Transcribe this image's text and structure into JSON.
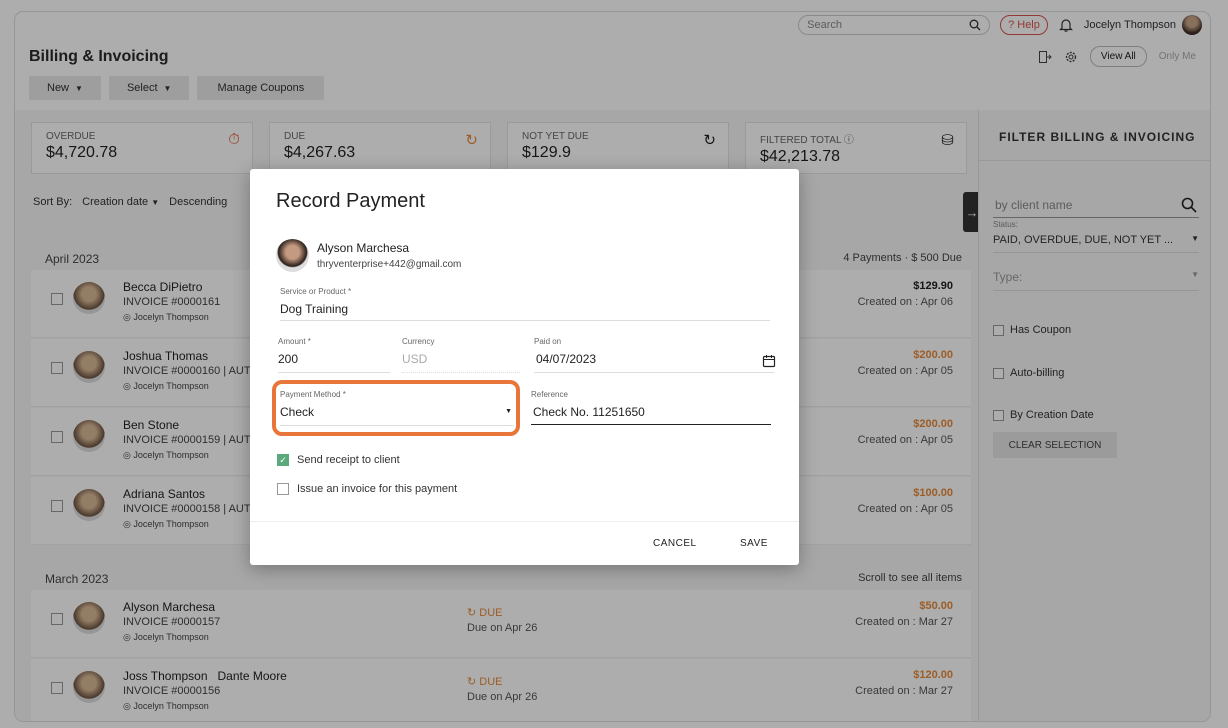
{
  "topbar": {
    "search_placeholder": "Search",
    "help": "Help",
    "user": "Jocelyn Thompson"
  },
  "header": {
    "title": "Billing & Invoicing",
    "view_all": "View All",
    "only_me": "Only Me"
  },
  "toolbar": {
    "new": "New",
    "select": "Select",
    "coupons": "Manage Coupons"
  },
  "cards": [
    {
      "label": "OVERDUE",
      "value": "$4,720.78",
      "icon": "stopwatch-icon",
      "color": "#e0552f"
    },
    {
      "label": "DUE",
      "value": "$4,267.63",
      "icon": "clock-refresh-icon",
      "color": "#e8893a"
    },
    {
      "label": "NOT YET DUE",
      "value": "$129.9",
      "icon": "clock-forward-icon",
      "color": "#333333"
    },
    {
      "label": "FILTERED TOTAL",
      "value": "$42,213.78",
      "icon": "coins-icon",
      "color": "#333333"
    }
  ],
  "sort": {
    "label": "Sort By:",
    "field": "Creation date",
    "order": "Descending"
  },
  "groups": [
    {
      "name": "April 2023",
      "summary": "4 Payments  ·  $ 500 Due"
    },
    {
      "name": "March 2023",
      "summary": "Scroll to see all items"
    }
  ],
  "rows": [
    {
      "name": "Becca DiPietro",
      "invoice": "INVOICE #0000161",
      "assignee": "Jocelyn Thompson",
      "amount": "$129.90",
      "amount_color": "#222222",
      "created": "Created on : Apr 06",
      "status": "",
      "due": ""
    },
    {
      "name": "Joshua Thomas",
      "invoice": "INVOICE #0000160 | AUTO",
      "assignee": "Jocelyn Thompson",
      "amount": "$200.00",
      "amount_color": "#e8893a",
      "created": "Created on : Apr 05",
      "status": "",
      "due": ""
    },
    {
      "name": "Ben Stone",
      "invoice": "INVOICE #0000159 | AUTO",
      "assignee": "Jocelyn Thompson",
      "amount": "$200.00",
      "amount_color": "#e8893a",
      "created": "Created on : Apr 05",
      "status": "",
      "due": ""
    },
    {
      "name": "Adriana Santos",
      "invoice": "INVOICE #0000158 | AUTO",
      "assignee": "Jocelyn Thompson",
      "amount": "$100.00",
      "amount_color": "#e8893a",
      "created": "Created on : Apr 05",
      "status": "",
      "due": ""
    },
    {
      "name": "Alyson Marchesa",
      "invoice": "INVOICE #0000157",
      "assignee": "Jocelyn Thompson",
      "amount": "$50.00",
      "amount_color": "#e8893a",
      "created": "Created on : Mar 27",
      "status": "DUE",
      "due": "Due on Apr 26"
    },
    {
      "name": "Joss Thompson   Dante Moore",
      "invoice": "INVOICE #0000156",
      "assignee": "Jocelyn Thompson",
      "amount": "$120.00",
      "amount_color": "#e8893a",
      "created": "Created on : Mar 27",
      "status": "DUE",
      "due": "Due on Apr 26"
    }
  ],
  "sidebar": {
    "title": "FILTER BILLING & INVOICING",
    "search_placeholder": "by client name",
    "status_label": "Status:",
    "status_value": "PAID, OVERDUE, DUE, NOT YET ...",
    "type_placeholder": "Type:",
    "checks": [
      "Has Coupon",
      "Auto-billing",
      "By Creation Date"
    ],
    "clear": "CLEAR SELECTION"
  },
  "modal": {
    "title": "Record Payment",
    "client_name": "Alyson Marchesa",
    "client_email": "thryventerprise+442@gmail.com",
    "service_label": "Service or Product *",
    "service_value": "Dog Training",
    "amount_label": "Amount *",
    "amount_value": "200",
    "currency_label": "Currency",
    "currency_value": "USD",
    "paid_label": "Paid on",
    "paid_value": "04/07/2023",
    "method_label": "Payment Method *",
    "method_value": "Check",
    "ref_label": "Reference",
    "ref_value": "Check No. 11251650",
    "send_receipt": "Send receipt to client",
    "send_receipt_checked": true,
    "issue_invoice": "Issue an invoice for this payment",
    "issue_invoice_checked": false,
    "cancel": "CANCEL",
    "save": "SAVE"
  },
  "colors": {
    "accent": "#e8763a",
    "checked": "#5aa97a"
  }
}
